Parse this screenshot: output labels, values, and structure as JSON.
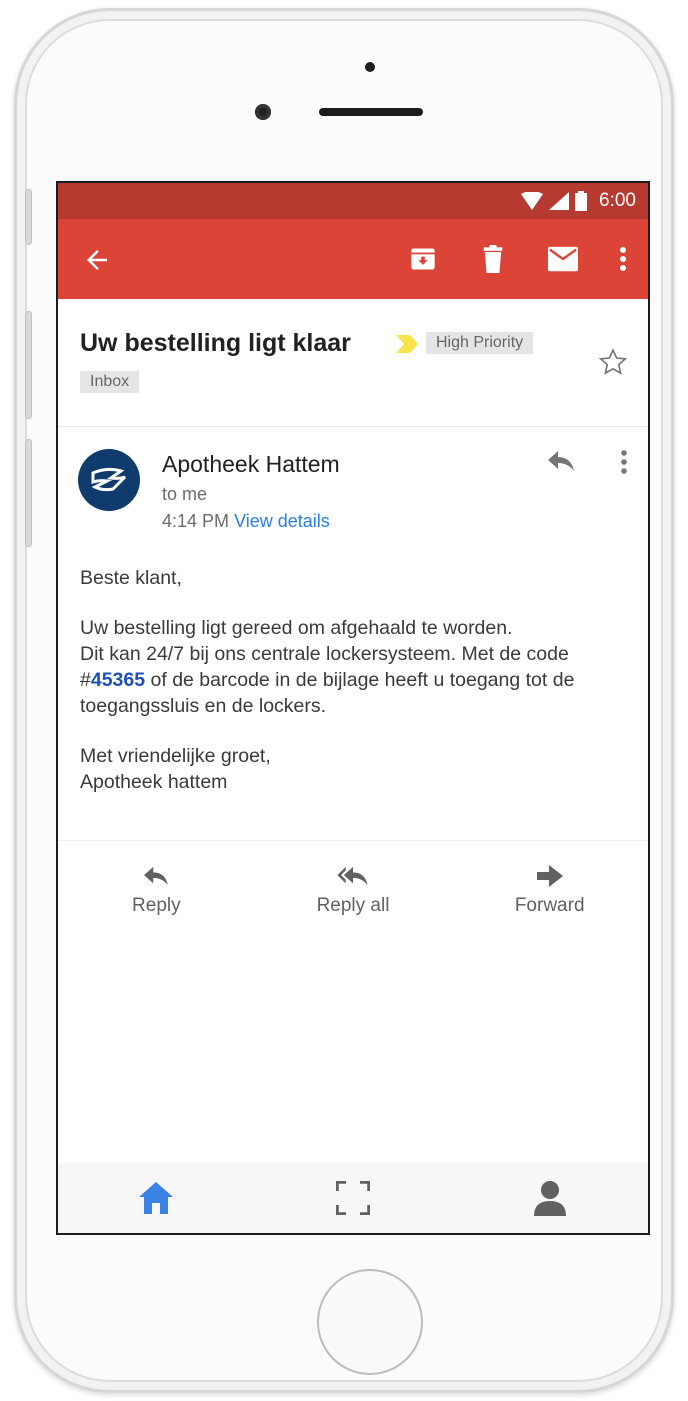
{
  "status_bar": {
    "time": "6:00"
  },
  "email": {
    "subject": "Uw bestelling ligt klaar",
    "labels": {
      "priority": "High Priority",
      "inbox": "Inbox"
    },
    "sender": {
      "name": "Apotheek Hattem",
      "recipient": "to me",
      "time": "4:14 PM",
      "details_link": "View details"
    },
    "body": {
      "greeting": "Beste klant,",
      "line1": "Uw bestelling ligt gereed om afgehaald te worden.",
      "line2": "Dit kan 24/7 bij ons centrale lockersysteem. Met de code",
      "hash": "#",
      "code": "45365",
      "line3": " of de barcode in de bijlage heeft u toegang tot  de toegangssluis en de lockers.",
      "closing": "Met vriendelijke groet,",
      "signature": "Apotheek hattem"
    }
  },
  "reply_bar": {
    "reply": "Reply",
    "reply_all": "Reply all",
    "forward": "Forward"
  },
  "colors": {
    "app_bar": "#db4437",
    "status_bar": "#b63a30",
    "link": "#2a7de1",
    "avatar": "#0f3c6c",
    "home_active": "#3b82e6"
  },
  "icons": [
    "back-arrow-icon",
    "archive-icon",
    "trash-icon",
    "mail-icon",
    "more-vert-icon",
    "star-icon",
    "reply-icon",
    "reply-all-icon",
    "forward-icon",
    "home-icon",
    "scan-icon",
    "person-icon"
  ]
}
